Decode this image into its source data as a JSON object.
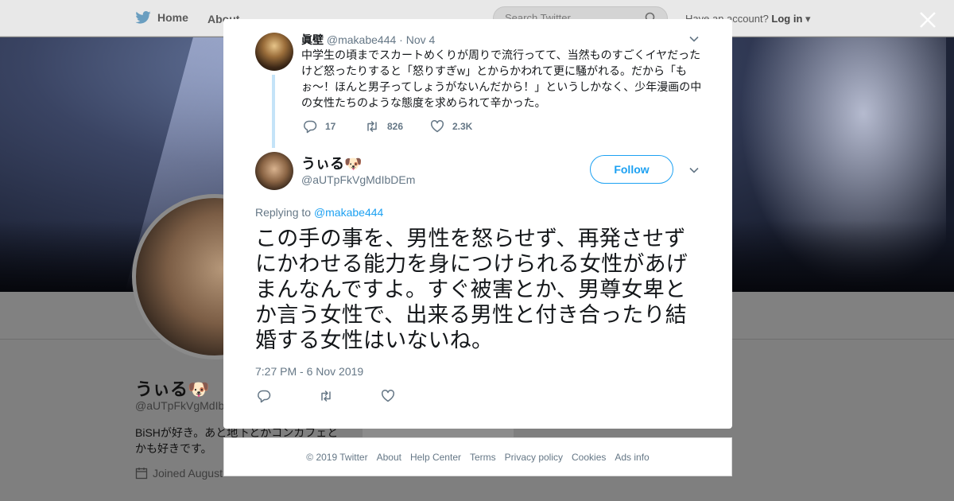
{
  "topbar": {
    "home_label": "Home",
    "about_label": "About",
    "search_placeholder": "Search Twitter",
    "have_account": "Have an account?",
    "login_label": "Log in"
  },
  "profile": {
    "name": "うぃる🐶",
    "handle": "@aUTpFkVgMdIbDEm",
    "bio": "BiSHが好き。あと地下とかコンカフェとかも好きです。",
    "joined": "Joined August"
  },
  "parent_tweet": {
    "name": "眞壁",
    "handle": "@makabe444",
    "date": "Nov 4",
    "text": "中学生の頃までスカートめくりが周りで流行ってて、当然ものすごくイヤだったけど怒ったりすると「怒りすぎw」とからかわれて更に騒がれる。だから「もぉ〜！ほんと男子ってしょうがないんだから！」というしかなく、少年漫画の中の女性たちのような態度を求められて辛かった。",
    "replies": "17",
    "retweets": "826",
    "likes": "2.3K"
  },
  "main_tweet": {
    "name": "うぃる🐶",
    "handle": "@aUTpFkVgMdIbDEm",
    "follow_label": "Follow",
    "replying_prefix": "Replying to",
    "replying_to": "@makabe444",
    "text": "この手の事を、男性を怒らせず、再発させずにかわせる能力を身につけられる女性があげまんなんですよ。すぐ被害とか、男尊女卑とか言う女性で、出来る男性と付き合ったり結婚する女性はいないね。",
    "timestamp": "7:27 PM - 6 Nov 2019"
  },
  "footer": {
    "copyright": "© 2019 Twitter",
    "about": "About",
    "help": "Help Center",
    "terms": "Terms",
    "privacy": "Privacy policy",
    "cookies": "Cookies",
    "ads": "Ads info"
  },
  "colors": {
    "accent": "#1da1f2",
    "muted": "#657786",
    "thread_line": "#c4e3f8"
  }
}
